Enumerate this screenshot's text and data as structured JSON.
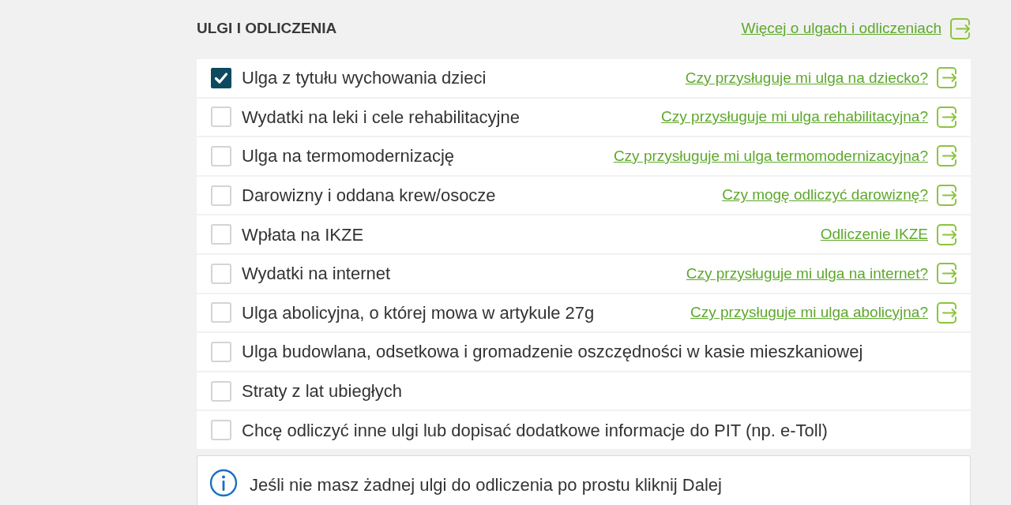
{
  "section": {
    "title": "ULGI I ODLICZENIA",
    "link": "Więcej o ulgach i odliczeniach"
  },
  "items": [
    {
      "label": "Ulga z tytułu wychowania dzieci",
      "checked": true,
      "link": "Czy przysługuje mi ulga na dziecko?"
    },
    {
      "label": "Wydatki na leki i cele rehabilitacyjne",
      "checked": false,
      "link": "Czy przysługuje mi ulga rehabilitacyjna?"
    },
    {
      "label": "Ulga na termomodernizację",
      "checked": false,
      "link": "Czy przysługuje mi ulga termomodernizacyjna?"
    },
    {
      "label": "Darowizny i oddana krew/osocze",
      "checked": false,
      "link": "Czy mogę odliczyć darowiznę?"
    },
    {
      "label": "Wpłata na IKZE",
      "checked": false,
      "link": "Odliczenie IKZE"
    },
    {
      "label": "Wydatki na internet",
      "checked": false,
      "link": "Czy przysługuje mi ulga na internet?"
    },
    {
      "label": "Ulga abolicyjna, o której mowa w artykule 27g",
      "checked": false,
      "link": "Czy przysługuje mi ulga abolicyjna?"
    },
    {
      "label": "Ulga budowlana, odsetkowa i gromadzenie oszczędności w kasie mieszkaniowej",
      "checked": false
    },
    {
      "label": "Straty z lat ubiegłych",
      "checked": false
    },
    {
      "label": "Chcę odliczyć inne ulgi lub dopisać dodatkowe informacje do PIT (np. e-Toll)",
      "checked": false
    }
  ],
  "info": {
    "text": "Jeśli nie masz żadnej ulgi do odliczenia po prostu kliknij Dalej"
  }
}
